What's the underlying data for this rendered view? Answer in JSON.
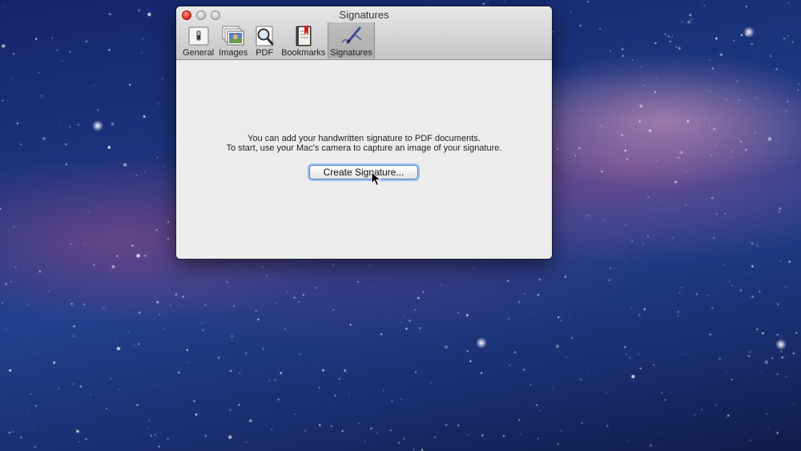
{
  "window": {
    "title": "Signatures",
    "tabs": [
      {
        "label": "General",
        "icon": "general-switch-icon"
      },
      {
        "label": "Images",
        "icon": "images-stack-icon"
      },
      {
        "label": "PDF",
        "icon": "pdf-magnifier-icon"
      },
      {
        "label": "Bookmarks",
        "icon": "bookmarks-book-icon"
      },
      {
        "label": "Signatures",
        "icon": "signature-pen-icon"
      }
    ],
    "selected_tab": "Signatures"
  },
  "content": {
    "line1": "You can add your handwritten signature to PDF documents.",
    "line2": "To start, use your Mac's camera to capture an image of your signature.",
    "create_button": "Create Signature..."
  },
  "colors": {
    "close": "#e0332a",
    "focus_ring": "#9ec0f0",
    "window_bg": "#ececec",
    "desktop": "#1d3580"
  }
}
